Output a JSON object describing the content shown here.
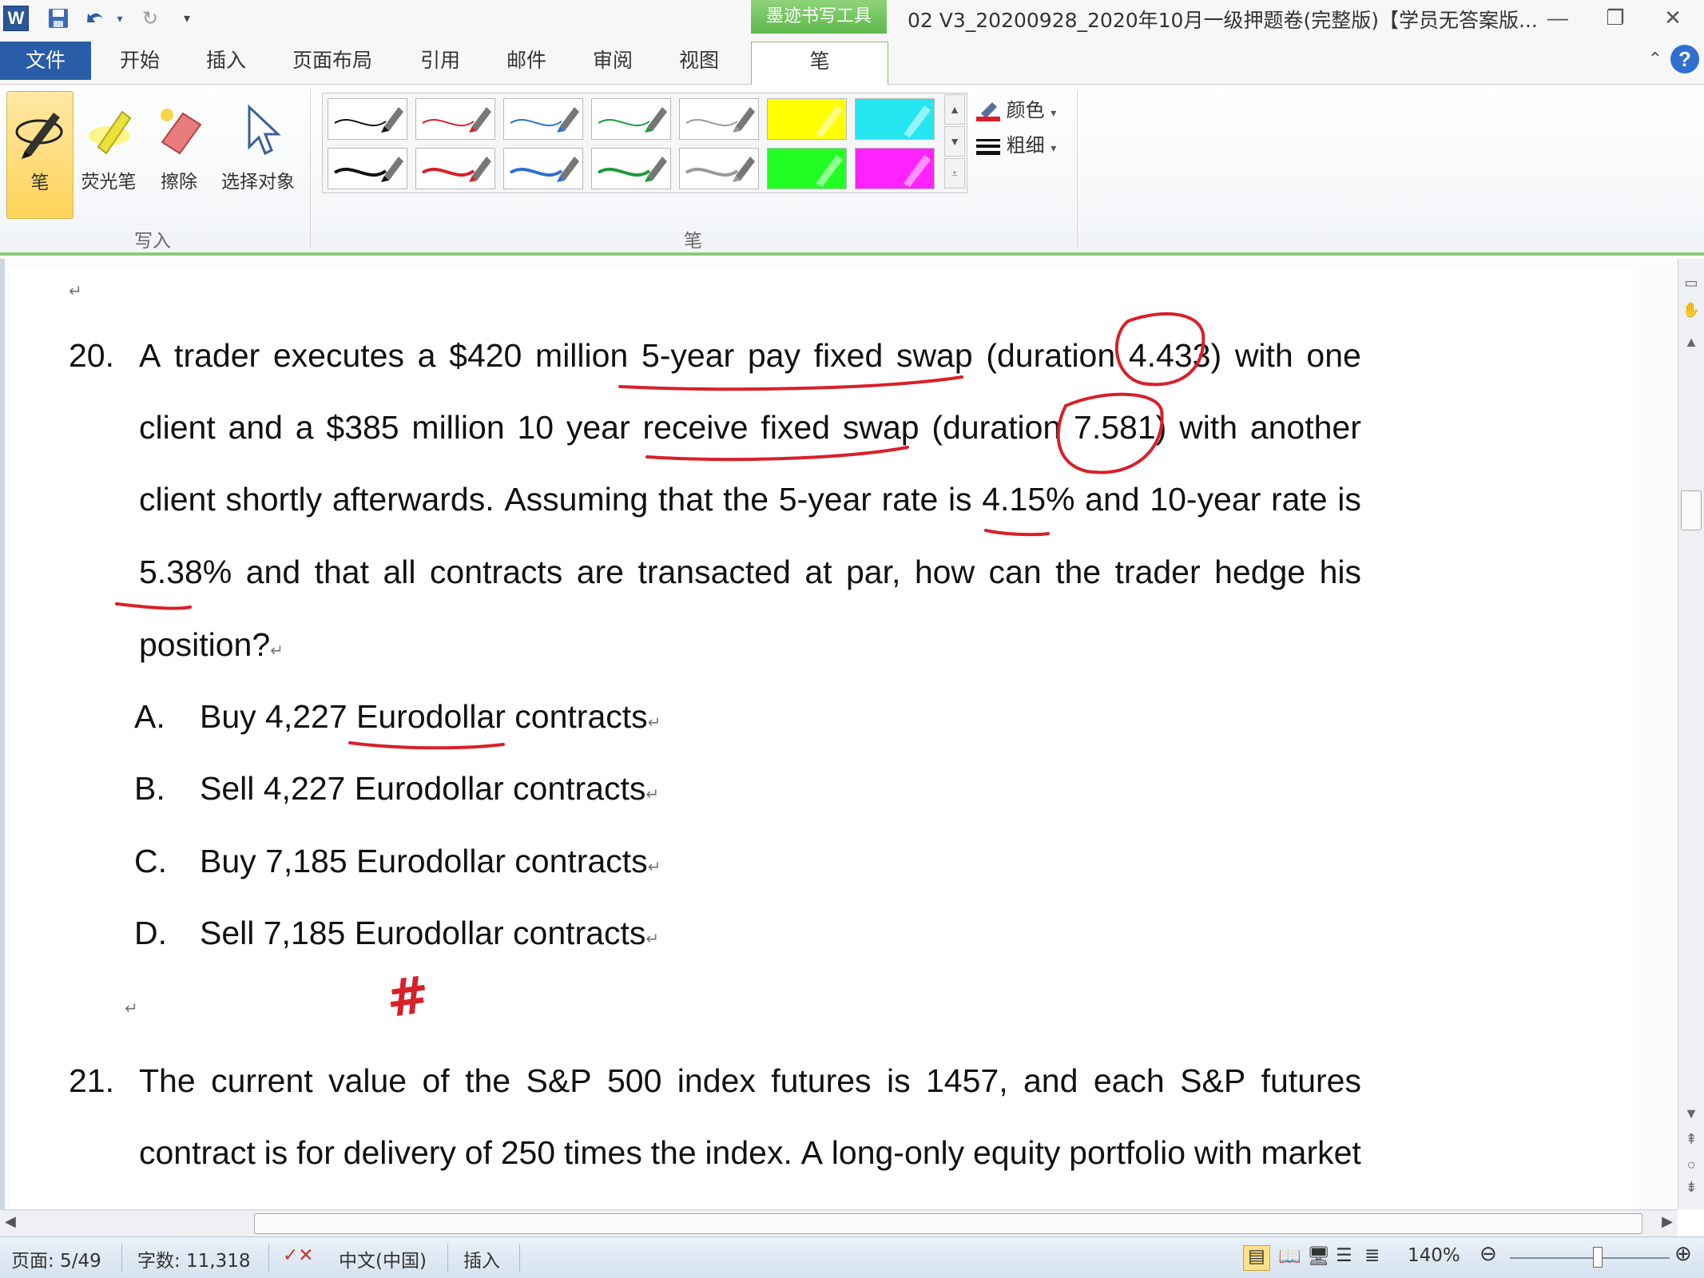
{
  "titlebar": {
    "app_icon": "W",
    "ink_context_label": "墨迹书写工具",
    "document_title": "02 V3_20200928_2020年10月一级押题卷(完整版)【学员无答案版...",
    "minimize_glyph": "—",
    "restore_glyph": "❐",
    "close_glyph": "✕"
  },
  "tabs": {
    "file": "文件",
    "items": [
      "开始",
      "插入",
      "页面布局",
      "引用",
      "邮件",
      "审阅",
      "视图"
    ],
    "pen": "笔"
  },
  "ribbon": {
    "write_group": {
      "label": "写入",
      "buttons": [
        "笔",
        "荧光笔",
        "擦除",
        "选择对象"
      ]
    },
    "pen_group": {
      "label": "笔",
      "color_label": "颜色",
      "weight_label": "粗细"
    },
    "swatch_colors": [
      "#111111",
      "#d8202a",
      "#2f6fd1",
      "#1f9a3b",
      "#9a9a9a",
      "#ffff00",
      "#25e6f0",
      "#111111",
      "#d8202a",
      "#2f6fd1",
      "#1f9a3b",
      "#9a9a9a",
      "#22ff22",
      "#ff22ff"
    ]
  },
  "document": {
    "q20": {
      "number": "20.",
      "lines": [
        [
          "A",
          "trader",
          "executes",
          "a",
          "$420",
          "million",
          "5-year",
          "pay",
          "fixed",
          "swap",
          "(duration",
          "4.433)",
          "with",
          "one"
        ],
        [
          "client",
          "and",
          "a",
          "$385",
          "million",
          "10",
          "year",
          "receive",
          "fixed",
          "swap",
          "(duration",
          "7.581)",
          "with",
          "another"
        ],
        [
          "client",
          "shortly",
          "afterwards.",
          "Assuming",
          "that",
          "the",
          "5-year",
          "rate",
          "is",
          "4.15%",
          "and",
          "10-year",
          "rate",
          "is"
        ],
        [
          "5.38%",
          "and",
          "that",
          "all",
          "contracts",
          "are",
          "transacted",
          "at",
          "par,",
          "how",
          "can",
          "the",
          "trader",
          "hedge",
          "his"
        ]
      ],
      "last_line": "position?",
      "options": [
        {
          "letter": "A.",
          "text": "Buy 4,227 Eurodollar contracts"
        },
        {
          "letter": "B.",
          "text": "Sell 4,227 Eurodollar contracts"
        },
        {
          "letter": "C.",
          "text": "Buy 7,185 Eurodollar contracts"
        },
        {
          "letter": "D.",
          "text": "Sell 7,185 Eurodollar contracts"
        }
      ]
    },
    "q21": {
      "number": "21.",
      "lines": [
        [
          "The",
          "current",
          "value",
          "of",
          "the",
          "S&P",
          "500",
          "index",
          "futures",
          "is",
          "1457,",
          "and",
          "each",
          "S&P",
          "futures"
        ],
        [
          "contract",
          "is",
          "for",
          "delivery",
          "of",
          "250",
          "times",
          "the",
          "index.",
          "A",
          "long-only",
          "equity",
          "portfolio",
          "with",
          "market"
        ]
      ]
    },
    "ink_mark": "#",
    "ink_color": "#d8202a"
  },
  "statusbar": {
    "page": "页面: 5/49",
    "words": "字数: 11,318",
    "language": "中文(中国)",
    "mode": "插入",
    "zoom": "140%",
    "zoom_level_percent": 140
  }
}
